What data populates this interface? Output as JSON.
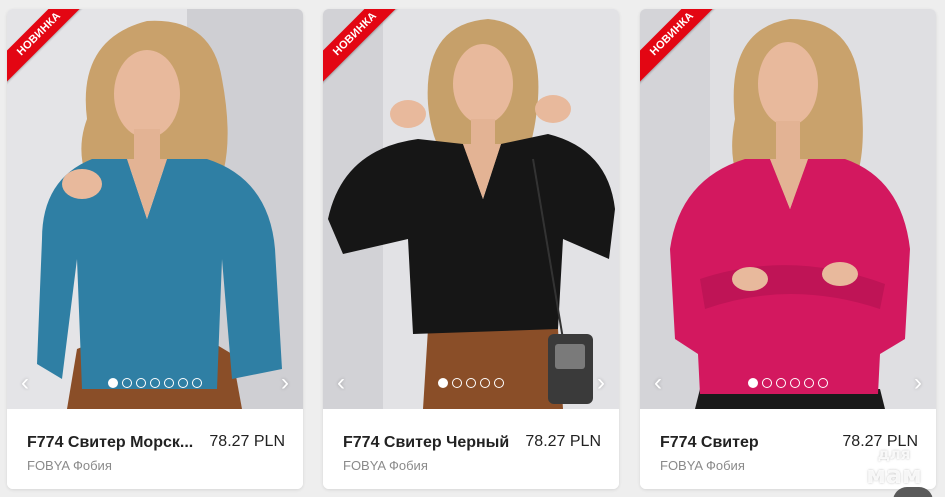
{
  "colors": {
    "badge": "#e30613",
    "card_bg": "#ffffff",
    "page_bg": "#eeeeee"
  },
  "products": [
    {
      "badge": "НОВИНКА",
      "name": "F774 Свитер Морск...",
      "price": "78.27 PLN",
      "brand": "FOBYA Фобия",
      "sweater_color": "#2f7fa4",
      "slides_total": 7,
      "slide_active": 1
    },
    {
      "badge": "НОВИНКА",
      "name": "F774 Свитер Черный",
      "price": "78.27 PLN",
      "brand": "FOBYA Фобия",
      "sweater_color": "#161616",
      "slides_total": 5,
      "slide_active": 1
    },
    {
      "badge": "НОВИНКА",
      "name": "F774 Свитер",
      "price": "78.27 PLN",
      "brand": "FOBYA Фобия",
      "sweater_color": "#d3185f",
      "slides_total": 6,
      "slide_active": 1
    }
  ],
  "carousel": {
    "prev_icon": "chevron-left-icon",
    "next_icon": "chevron-right-icon",
    "prev_glyph": "‹",
    "next_glyph": "›"
  },
  "watermark": {
    "line1": "для",
    "line2": "мам"
  }
}
